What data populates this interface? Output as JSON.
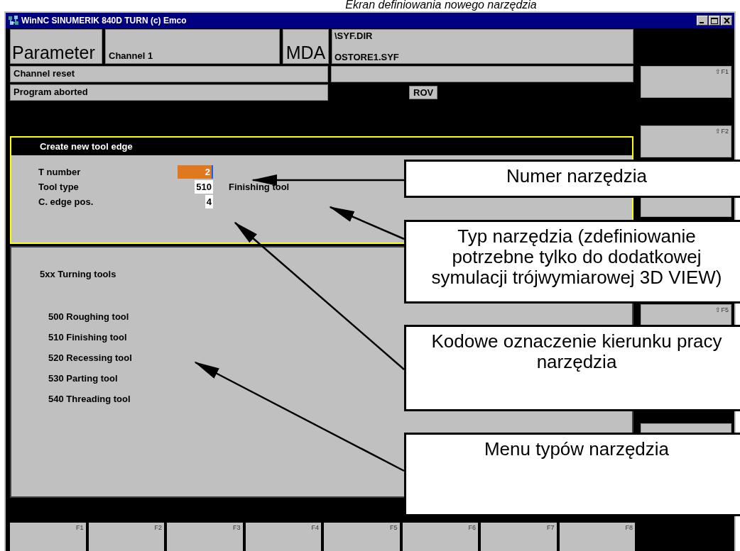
{
  "caption": "Ekran definiowania nowego narzędzia",
  "window": {
    "title": "WinNC SINUMERIK 840D TURN (c) Emco"
  },
  "header": {
    "area": "Parameter",
    "channel": "Channel 1",
    "mode": "MDA",
    "path": [
      "\\SYF.DIR",
      "OSTORE1.SYF"
    ]
  },
  "status": {
    "channel_state": "Channel reset",
    "program_state": "Program aborted",
    "override": "ROV"
  },
  "dialog": {
    "title": "Create new tool edge",
    "fields": [
      {
        "label": "T number",
        "value": "2",
        "focused": true
      },
      {
        "label": "Tool type",
        "value": "510",
        "focused": false,
        "description": "Finishing tool"
      },
      {
        "label": "C. edge pos.",
        "value": "4",
        "focused": false
      }
    ]
  },
  "tool_menu": {
    "heading": "5xx Turning tools",
    "items": [
      "500 Roughing tool",
      "510 Finishing tool",
      "520 Recessing tool",
      "530 Parting tool",
      "540 Threading tool"
    ]
  },
  "side_softkeys": [
    {
      "kind": "labeled",
      "label": "⇧F1"
    },
    {
      "kind": "labeled",
      "label": "⇧F2"
    },
    {
      "kind": "blank"
    },
    {
      "kind": "covered"
    },
    {
      "kind": "labeled",
      "label": "⇧F5"
    },
    {
      "kind": "covered"
    },
    {
      "kind": "blank"
    }
  ],
  "bottom_softkeys": [
    "F1",
    "F2",
    "F3",
    "F4",
    "F5",
    "F6",
    "F7",
    "F8"
  ],
  "callouts": [
    {
      "text": "Numer narzędzia"
    },
    {
      "text": "Typ narzędzia (zdefiniowanie potrzebne tylko do dodatkowej symulacji trójwymiarowej 3D VIEW)"
    },
    {
      "text": "Kodowe oznaczenie kierunku pracy narzędzia"
    },
    {
      "text": "Menu typów narzędzia"
    }
  ]
}
